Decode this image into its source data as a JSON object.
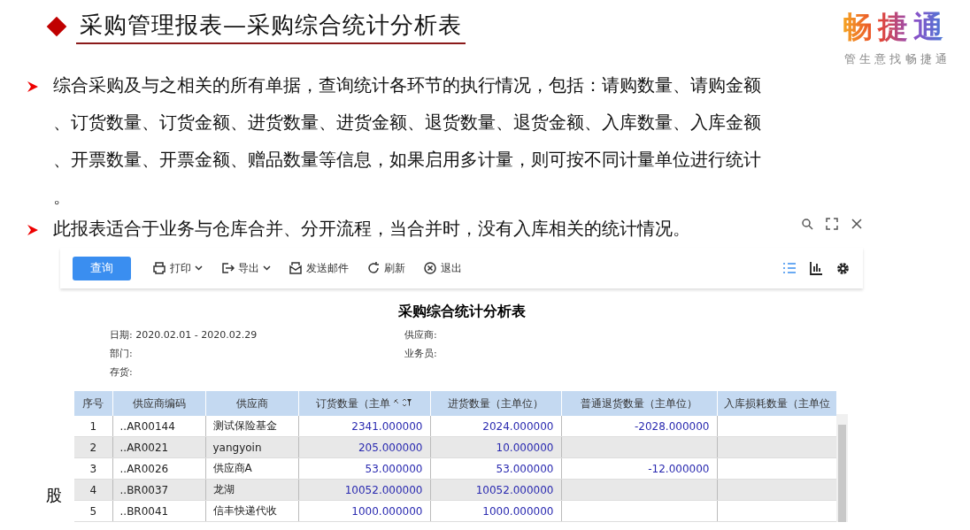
{
  "slide": {
    "title": "采购管理报表—采购综合统计分析表",
    "logo": {
      "name": "畅捷通",
      "slogan": "管 生 意 找 畅 捷 通"
    },
    "bullets": [
      {
        "lines": [
          "综合采购及与之相关的所有单据，查询统计各环节的执行情况，包括：请购数量、请购金额",
          "、订货数量、订货金额、进货数量、进货金额、退货数量、退货金额、入库数量、入库金额",
          "、开票数量、开票金额、赠品数量等信息，如果启用多计量，则可按不同计量单位进行统计",
          "。"
        ]
      },
      {
        "lines": [
          "此报表适合于业务与仓库合并、分开流程，当合并时，没有入库相关的统计情况。"
        ]
      }
    ],
    "stray_char": "股"
  },
  "toolbar": {
    "query_button": "查询",
    "items": [
      {
        "kind": "print",
        "label": "打印",
        "dropdown": true
      },
      {
        "kind": "export",
        "label": "导出",
        "dropdown": true
      },
      {
        "kind": "mail",
        "label": "发送邮件",
        "dropdown": false
      },
      {
        "kind": "refresh",
        "label": "刷新",
        "dropdown": false
      },
      {
        "kind": "exit",
        "label": "退出",
        "dropdown": false
      }
    ]
  },
  "report": {
    "title": "采购综合统计分析表",
    "filters": [
      {
        "label": "日期:",
        "value": "2020.02.01 - 2020.02.29"
      },
      {
        "label": "供应商:"
      },
      {
        "label": "部门:"
      },
      {
        "label": "业务员:"
      },
      {
        "label": "存货:"
      }
    ],
    "columns": [
      "序号",
      "供应商编码",
      "供应商",
      "订货数量（主单",
      "进货数量（主单位）",
      "普通退货数量（主单位）",
      "入库损耗数量（主单位"
    ],
    "rows": [
      [
        "1",
        "..AR00144",
        "测试保险基金",
        "2341.000000",
        "2024.000000",
        "-2028.000000",
        ""
      ],
      [
        "2",
        "..AR0021",
        "yangyoin",
        "205.000000",
        "10.000000",
        "",
        ""
      ],
      [
        "3",
        "..AR0026",
        "供应商A",
        "53.000000",
        "53.000000",
        "-12.000000",
        ""
      ],
      [
        "4",
        "..BR0037",
        "龙湖",
        "10052.000000",
        "10052.000000",
        "",
        ""
      ],
      [
        "5",
        "..BR0041",
        "信丰快递代收",
        "1000.000000",
        "1000.000000",
        "",
        ""
      ]
    ]
  }
}
